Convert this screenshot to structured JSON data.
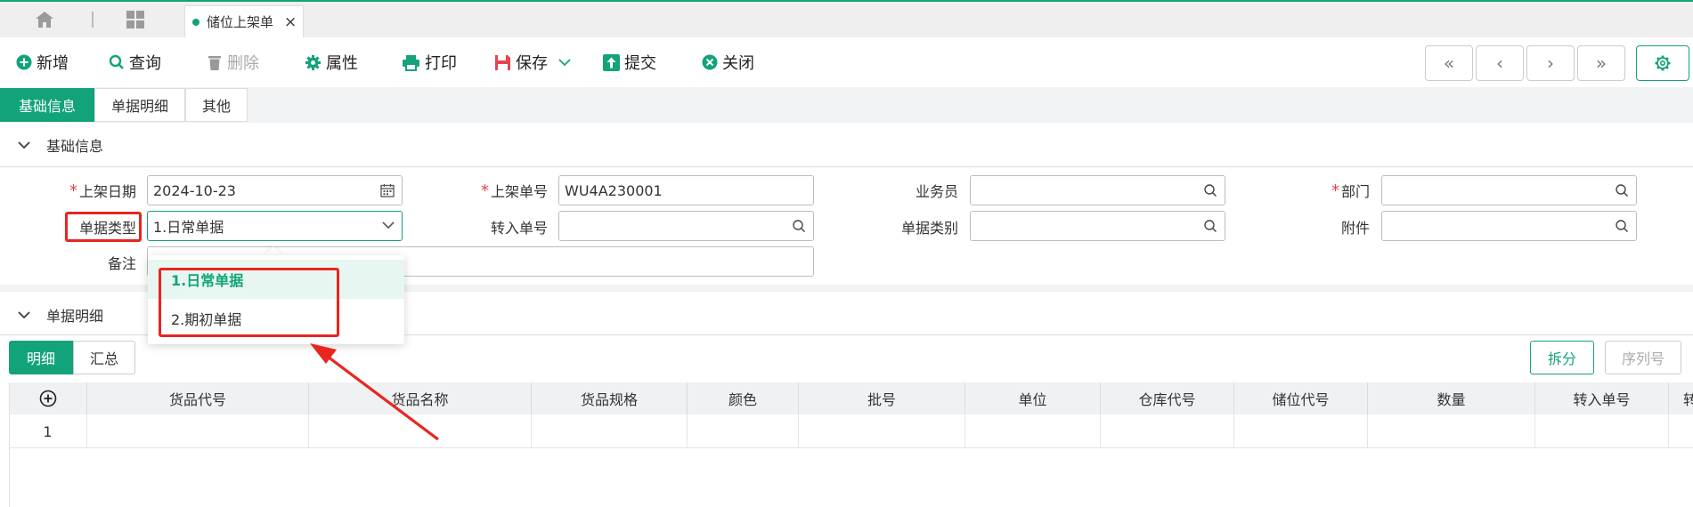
{
  "topbar": {
    "doc_tab_label": "储位上架单",
    "close_glyph": "×"
  },
  "toolbar": {
    "add": "新增",
    "query": "查询",
    "delete": "删除",
    "properties": "属性",
    "print": "打印",
    "save": "保存",
    "submit": "提交",
    "close": "关闭",
    "nav_first": "«",
    "nav_prev": "‹",
    "nav_next": "›",
    "nav_last": "»"
  },
  "section_tabs": [
    "基础信息",
    "单据明细",
    "其他"
  ],
  "basic_panel": {
    "title": "基础信息",
    "fields": {
      "shelf_date_label": "上架日期",
      "shelf_date_value": "2024-10-23",
      "shelf_no_label": "上架单号",
      "shelf_no_value": "WU4A230001",
      "salesman_label": "业务员",
      "department_label": "部门",
      "doc_type_label": "单据类型",
      "doc_type_value": "1.日常单据",
      "transfer_no_label": "转入单号",
      "doc_category_label": "单据类别",
      "attachment_label": "附件",
      "remark_label": "备注",
      "required_mark": "*"
    }
  },
  "dropdown": {
    "options": [
      "1.日常单据",
      "2.期初单据"
    ],
    "selected_index": 0
  },
  "detail_panel": {
    "title": "单据明细",
    "subtabs": [
      "明细",
      "汇总"
    ],
    "split_btn": "拆分",
    "serial_btn": "序列号",
    "columns": [
      "货品代号",
      "货品名称",
      "货品规格",
      "颜色",
      "批号",
      "单位",
      "仓库代号",
      "储位代号",
      "数量",
      "转入单号",
      "转"
    ],
    "rows": [
      {
        "index": "1"
      }
    ]
  },
  "colors": {
    "accent": "#13a37a",
    "highlight_red": "#e8251f",
    "required": "#e84343"
  }
}
